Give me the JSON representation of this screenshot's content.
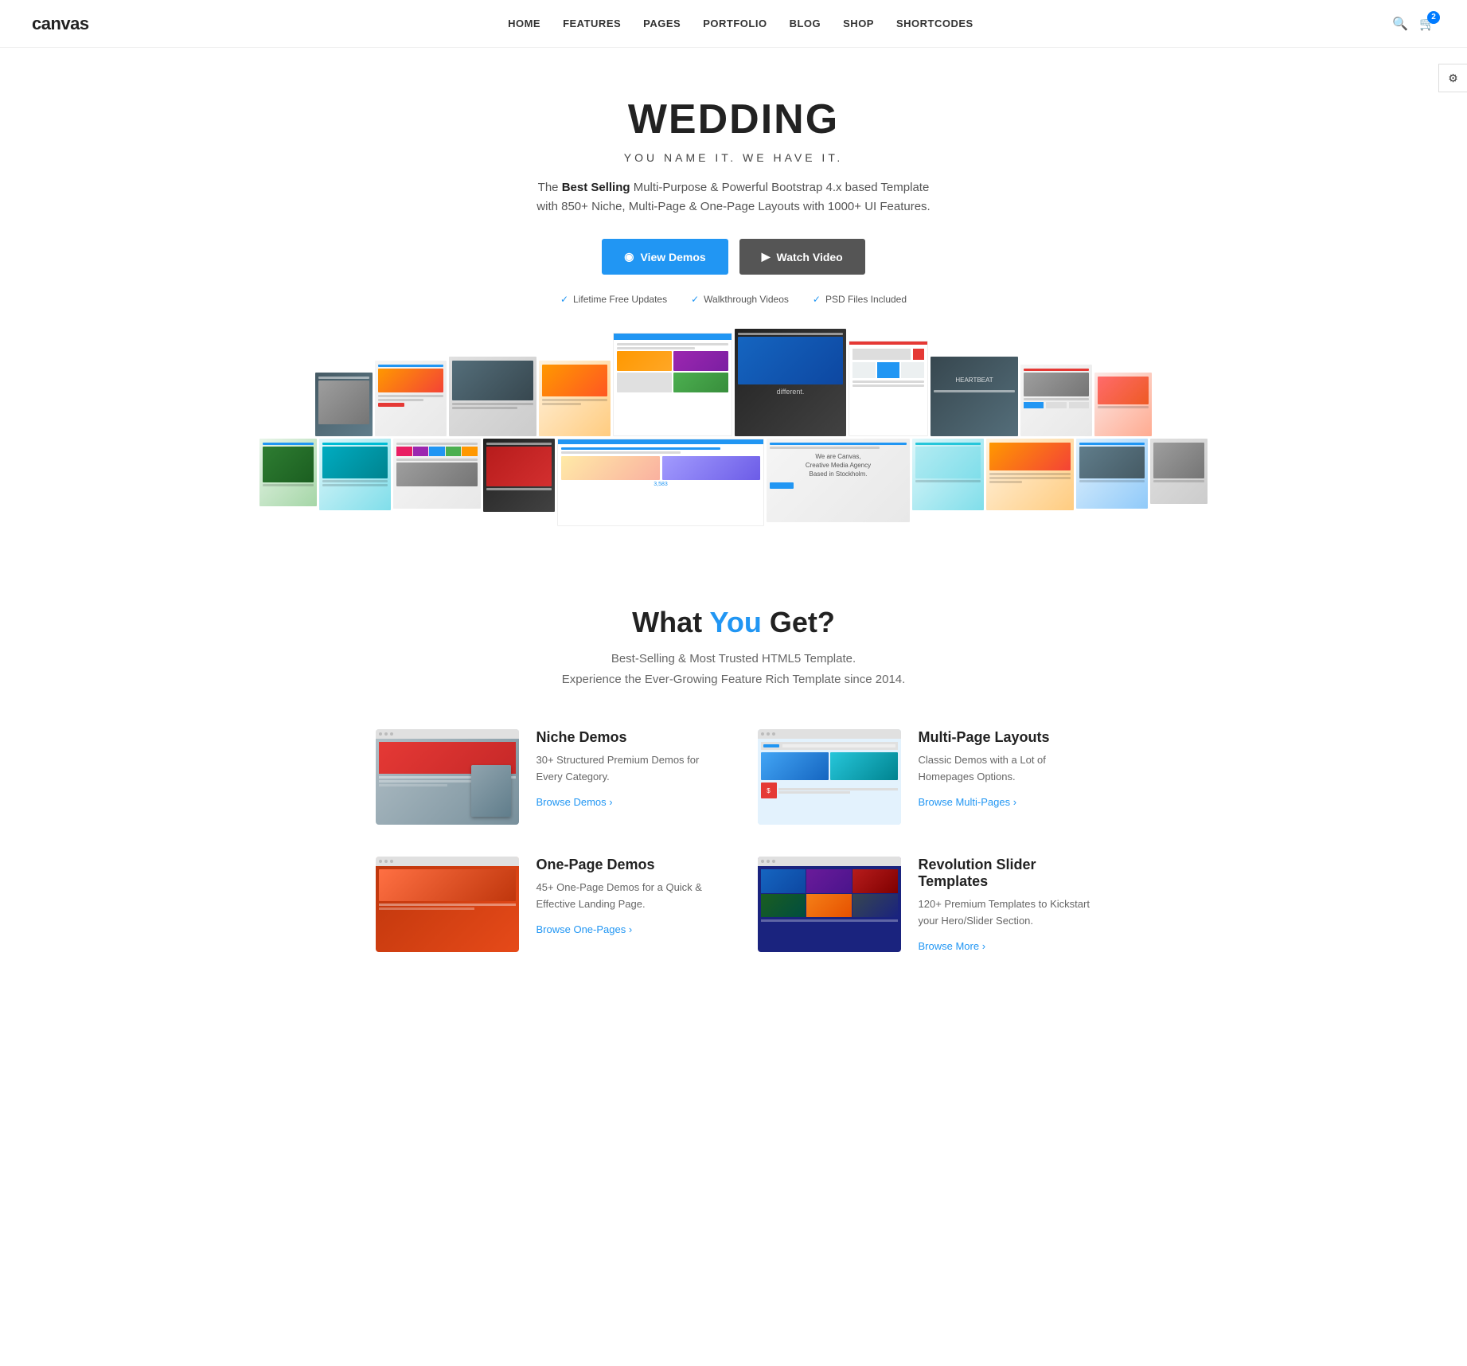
{
  "nav": {
    "logo": "canvas",
    "links": [
      "HOME",
      "FEATURES",
      "PAGES",
      "PORTFOLIO",
      "BLOG",
      "SHOP",
      "SHORTCODES"
    ],
    "cart_count": "2"
  },
  "hero": {
    "title": "WEDDING",
    "subtitle": "YOU NAME IT. WE HAVE IT.",
    "description_prefix": "The ",
    "description_bold": "Best Selling",
    "description_suffix": " Multi-Purpose & Powerful Bootstrap 4.x based Template with 850+ Niche, Multi-Page & One-Page Layouts with 1000+ UI Features.",
    "btn_demos": "View Demos",
    "btn_watch": "Watch Video",
    "badge1": "Lifetime Free Updates",
    "badge2": "Walkthrough Videos",
    "badge3": "PSD Files Included"
  },
  "what_you_get": {
    "title_prefix": "What ",
    "title_highlight": "You",
    "title_suffix": " Get?",
    "subtitle_line1": "Best-Selling & Most Trusted HTML5 Template.",
    "subtitle_line2": "Experience the Ever-Growing Feature Rich Template since 2014.",
    "features": [
      {
        "title": "Niche Demos",
        "desc": "30+ Structured Premium Demos for Every Category.",
        "link": "Browse Demos ›"
      },
      {
        "title": "Multi-Page Layouts",
        "desc": "Classic Demos with a Lot of Homepages Options.",
        "link": "Browse Multi-Pages ›"
      },
      {
        "title": "One-Page Demos",
        "desc": "45+ One-Page Demos for a Quick & Effective Landing Page.",
        "link": "Browse One-Pages ›"
      },
      {
        "title": "Revolution Slider Templates",
        "desc": "120+ Premium Templates to Kickstart your Hero/Slider Section.",
        "link": "Browse More ›"
      }
    ]
  },
  "icons": {
    "play": "▶",
    "monitor": "◉",
    "check": "✓",
    "video": "▶",
    "refresh": "↻",
    "psd": "◈",
    "search": "🔍",
    "cart": "🛒",
    "settings": "⚙"
  }
}
